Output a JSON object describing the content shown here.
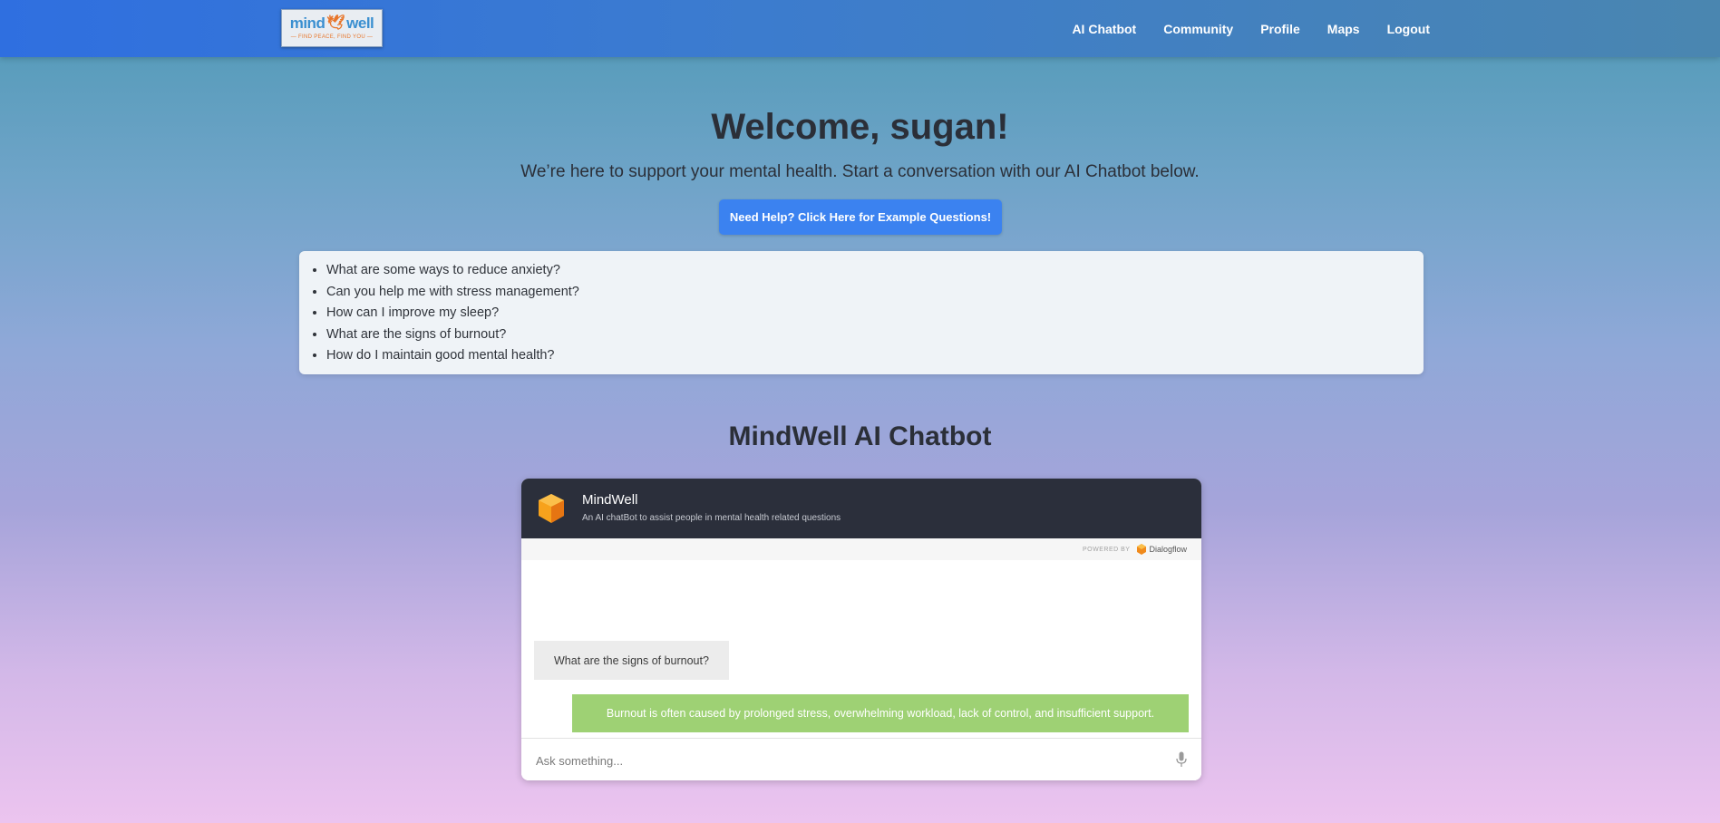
{
  "header": {
    "logo": {
      "text_left": "mind",
      "text_right": "well",
      "tagline": "— FIND PEACE, FIND YOU —"
    },
    "nav": [
      {
        "label": "AI Chatbot"
      },
      {
        "label": "Community"
      },
      {
        "label": "Profile"
      },
      {
        "label": "Maps"
      },
      {
        "label": "Logout"
      }
    ]
  },
  "hero": {
    "title": "Welcome, sugan!",
    "subtitle": "We’re here to support your mental health. Start a conversation with our AI Chatbot below.",
    "help_button": "Need Help? Click Here for Example Questions!"
  },
  "example_questions": [
    "What are some ways to reduce anxiety?",
    "Can you help me with stress management?",
    "How can I improve my sleep?",
    "What are the signs of burnout?",
    "How do I maintain good mental health?"
  ],
  "chatbot": {
    "section_title": "MindWell AI Chatbot",
    "bot_name": "MindWell",
    "bot_description": "An AI chatBot to assist people in mental health related questions",
    "powered_by": "POWERED BY",
    "provider": "Dialogflow",
    "messages": [
      {
        "from": "user",
        "text": "What are the signs of burnout?"
      },
      {
        "from": "bot",
        "text": "Burnout is often caused by prolonged stress, overwhelming workload, lack of control, and insufficient support."
      }
    ],
    "input_placeholder": "Ask something..."
  },
  "colors": {
    "header": "#3b7bd0",
    "accent_button": "#3b82f0",
    "chat_header": "#2b2f3b",
    "bot_bubble": "#9ed174",
    "user_bubble": "#ececec",
    "cube": "#f08a1c"
  },
  "icons": [
    "logo-bird-icon",
    "dialogflow-cube-icon",
    "microphone-icon"
  ]
}
